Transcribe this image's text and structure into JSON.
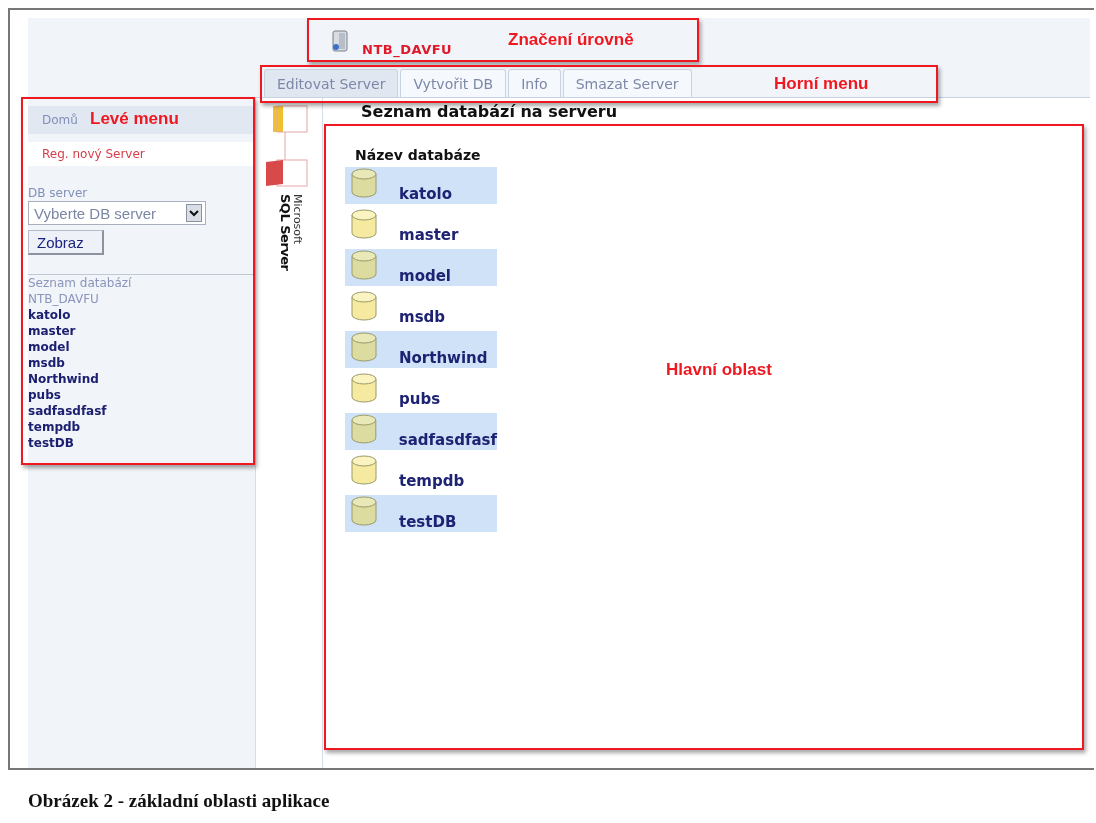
{
  "header": {
    "server_name": "NTB_DAVFU"
  },
  "tabs": [
    {
      "label": "Editovat Server",
      "selected": true
    },
    {
      "label": "Vytvořit DB",
      "selected": false
    },
    {
      "label": "Info",
      "selected": false
    },
    {
      "label": "Smazat Server",
      "selected": false
    }
  ],
  "left_menu": {
    "items": [
      "Domů",
      "Reg. nový Server"
    ],
    "db_server_label": "DB server",
    "select_placeholder": "Vyberte DB server",
    "show_button": "Zobraz",
    "list_title": "Seznam databází",
    "list_server": "NTB_DAVFU",
    "databases": [
      "katolo",
      "master",
      "model",
      "msdb",
      "Northwind",
      "pubs",
      "sadfasdfasf",
      "tempdb",
      "testDB"
    ]
  },
  "logo": {
    "line_1": "Microsoft",
    "line_2": "SQL Server"
  },
  "main": {
    "title": "Seznam databází na serveru",
    "column": "Název databáze",
    "rows": [
      "katolo",
      "master",
      "model",
      "msdb",
      "Northwind",
      "pubs",
      "sadfasdfasf",
      "tempdb",
      "testDB"
    ]
  },
  "annotations": [
    {
      "kind": "level",
      "label": "Značení úrovně"
    },
    {
      "kind": "top",
      "label": "Horní menu"
    },
    {
      "kind": "left",
      "label": "Levé menu"
    },
    {
      "kind": "main",
      "label": "Hlavní oblast"
    }
  ],
  "caption": "Obrázek 2 - základní oblasti aplikace"
}
